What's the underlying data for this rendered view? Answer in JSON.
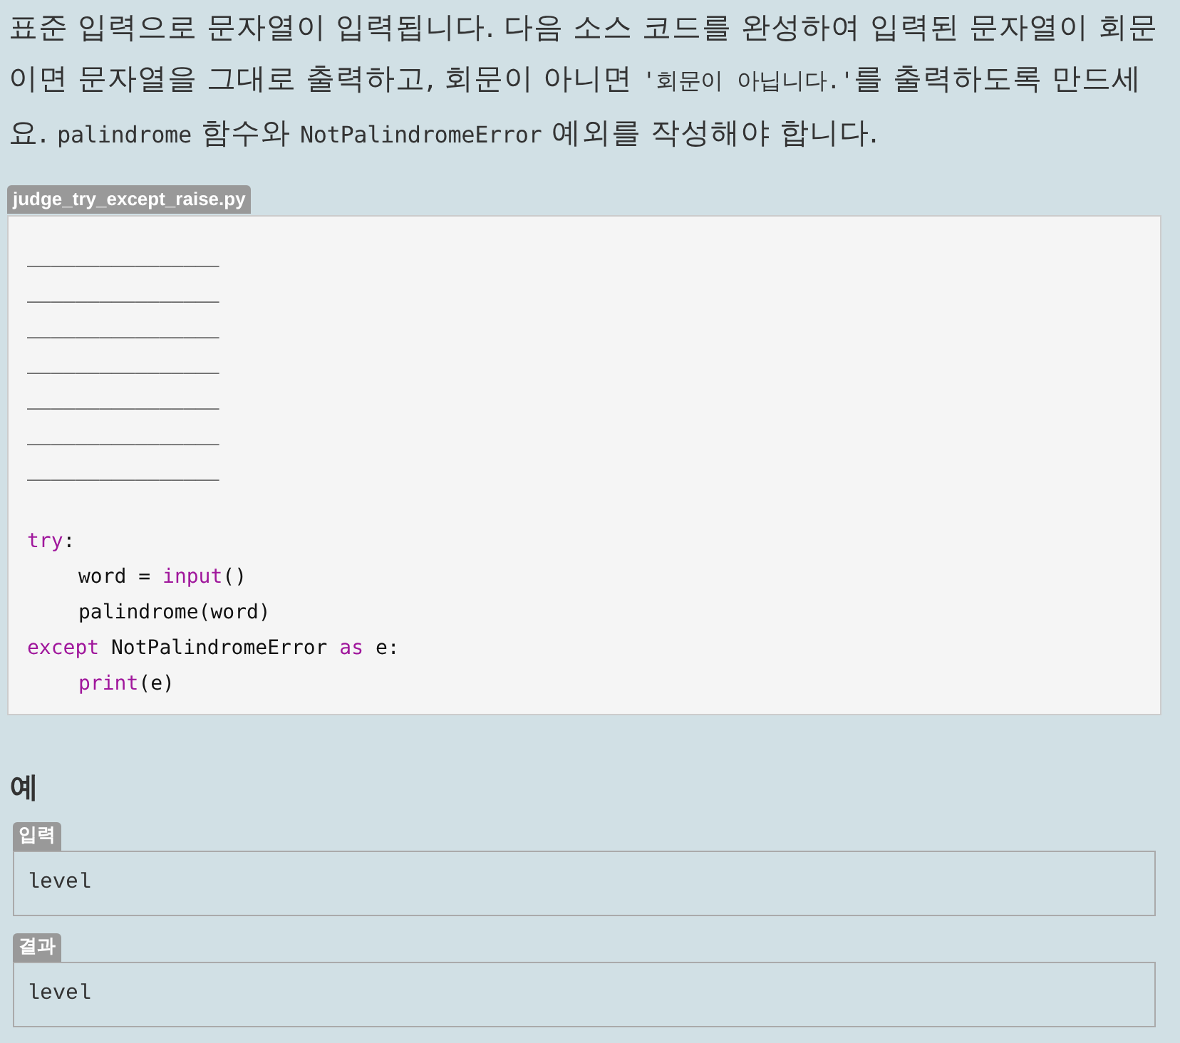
{
  "description": [
    {
      "kind": "text",
      "text": "표준 입력으로 문자열이 입력됩니다. 다음 소스 코드를 완성하여 입력된 문자열이 회문이면 문자열을 그대로 출력하고, 회문이 아니면 "
    },
    {
      "kind": "code",
      "text": "'회문이 아닙니다.'"
    },
    {
      "kind": "text",
      "text": "를 출력하도록 만드세요. "
    },
    {
      "kind": "code",
      "text": "palindrome"
    },
    {
      "kind": "text",
      "text": " 함수와 "
    },
    {
      "kind": "code",
      "text": "NotPalindromeError"
    },
    {
      "kind": "text",
      "text": " 예외를 작성해야 합니다."
    }
  ],
  "code_file": {
    "filename": "judge_try_except_raise.py",
    "lines": [
      {
        "blank_before": false,
        "indented": false,
        "tokens": [
          {
            "kind": "plain",
            "text": "________________"
          }
        ]
      },
      {
        "blank_before": false,
        "indented": false,
        "tokens": [
          {
            "kind": "plain",
            "text": "________________"
          }
        ]
      },
      {
        "blank_before": false,
        "indented": false,
        "tokens": [
          {
            "kind": "plain",
            "text": "________________"
          }
        ]
      },
      {
        "blank_before": false,
        "indented": false,
        "tokens": [
          {
            "kind": "plain",
            "text": "________________"
          }
        ]
      },
      {
        "blank_before": false,
        "indented": false,
        "tokens": [
          {
            "kind": "plain",
            "text": "________________"
          }
        ]
      },
      {
        "blank_before": false,
        "indented": false,
        "tokens": [
          {
            "kind": "plain",
            "text": "________________"
          }
        ]
      },
      {
        "blank_before": false,
        "indented": false,
        "tokens": [
          {
            "kind": "plain",
            "text": "________________"
          }
        ]
      },
      {
        "blank_before": true,
        "indented": false,
        "tokens": [
          {
            "kind": "keyword",
            "text": "try"
          },
          {
            "kind": "plain",
            "text": ":"
          }
        ]
      },
      {
        "blank_before": false,
        "indented": true,
        "tokens": [
          {
            "kind": "plain",
            "text": "word = "
          },
          {
            "kind": "keyword",
            "text": "input"
          },
          {
            "kind": "plain",
            "text": "()"
          }
        ]
      },
      {
        "blank_before": false,
        "indented": true,
        "tokens": [
          {
            "kind": "plain",
            "text": "palindrome(word)"
          }
        ]
      },
      {
        "blank_before": false,
        "indented": false,
        "tokens": [
          {
            "kind": "keyword",
            "text": "except"
          },
          {
            "kind": "plain",
            "text": " NotPalindromeError "
          },
          {
            "kind": "keyword",
            "text": "as"
          },
          {
            "kind": "plain",
            "text": " e:"
          }
        ]
      },
      {
        "blank_before": false,
        "indented": true,
        "tokens": [
          {
            "kind": "keyword",
            "text": "print"
          },
          {
            "kind": "plain",
            "text": "(e)"
          }
        ]
      }
    ]
  },
  "example": {
    "heading": "예",
    "blocks": [
      {
        "label": "입력",
        "value": "level"
      },
      {
        "label": "결과",
        "value": "level"
      }
    ]
  }
}
